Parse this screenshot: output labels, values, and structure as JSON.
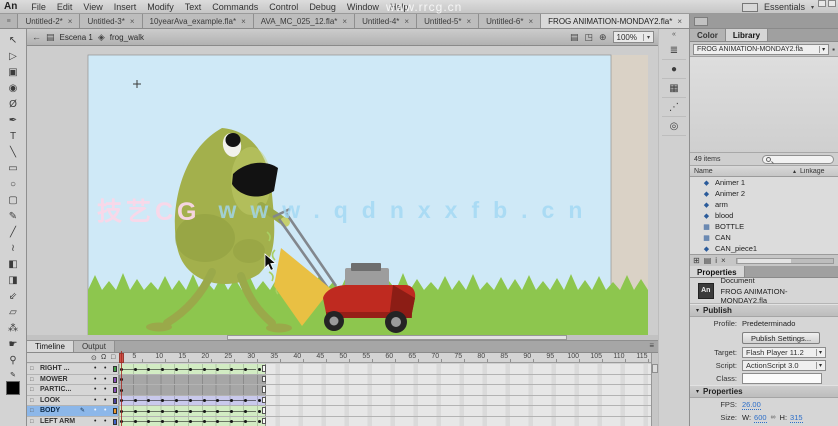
{
  "ui": {
    "close": "×",
    "dropdown": "▾",
    "back": "←",
    "scene_icon": "▤",
    "symbol_icon": "◈",
    "menu_icon": "≡",
    "collapse": "«",
    "eye": "⊙",
    "lock": "Ω",
    "outline": "□",
    "layer_icon": "□",
    "pencil": "✎",
    "sort": "▴",
    "movieclip_icon": "◆",
    "bitmap_icon": "▦",
    "pin": "▪",
    "dot": "•"
  },
  "menu_bar": {
    "logo": "An",
    "items": [
      "File",
      "Edit",
      "View",
      "Insert",
      "Modify",
      "Text",
      "Commands",
      "Control",
      "Debug",
      "Window",
      "Help"
    ],
    "watermark": "www.rrcg.cn",
    "workspace_label": "Essentials"
  },
  "document_tabs": [
    {
      "label": "Untitled-2*",
      "active": false
    },
    {
      "label": "Untitled-3*",
      "active": false
    },
    {
      "label": "10yearAva_example.fla*",
      "active": false
    },
    {
      "label": "AVA_MC_025_12.fla*",
      "active": false
    },
    {
      "label": "Untitled-4*",
      "active": false
    },
    {
      "label": "Untitled-5*",
      "active": false
    },
    {
      "label": "Untitled-6*",
      "active": false
    },
    {
      "label": "FROG ANIMATION-MONDAY2.fla*",
      "active": true
    }
  ],
  "edit_bar": {
    "scene": "Escena 1",
    "symbol": "frog_walk",
    "zoom_level": "100%",
    "right_icons": [
      {
        "name": "edit-scene-icon",
        "glyph": "▤"
      },
      {
        "name": "edit-symbols-icon",
        "glyph": "◳"
      },
      {
        "name": "center-frame-icon",
        "glyph": "⊕"
      }
    ]
  },
  "tools": [
    {
      "name": "selection-tool",
      "glyph": "↖"
    },
    {
      "name": "subselection-tool",
      "glyph": "▷"
    },
    {
      "name": "free-transform-tool",
      "glyph": "▣"
    },
    {
      "name": "3d-rotation-tool",
      "glyph": "◉"
    },
    {
      "name": "lasso-tool",
      "glyph": "Ø"
    },
    {
      "name": "pen-tool",
      "glyph": "✒"
    },
    {
      "name": "text-tool",
      "glyph": "T"
    },
    {
      "name": "line-tool",
      "glyph": "╲"
    },
    {
      "name": "rectangle-tool",
      "glyph": "▭"
    },
    {
      "name": "oval-tool",
      "glyph": "○"
    },
    {
      "name": "primitive-rect-tool",
      "glyph": "▢"
    },
    {
      "name": "pencil-tool",
      "glyph": "✎"
    },
    {
      "name": "brush-tool",
      "glyph": "╱"
    },
    {
      "name": "bone-tool",
      "glyph": "≀"
    },
    {
      "name": "paint-bucket-tool",
      "glyph": "◧"
    },
    {
      "name": "ink-bottle-tool",
      "glyph": "◨"
    },
    {
      "name": "eyedropper-tool",
      "glyph": "⇙"
    },
    {
      "name": "eraser-tool",
      "glyph": "▱"
    },
    {
      "name": "spray-brush-tool",
      "glyph": "⁂"
    },
    {
      "name": "hand-tool",
      "glyph": "☛"
    },
    {
      "name": "zoom-tool",
      "glyph": "⚲"
    }
  ],
  "stage": {
    "watermark_cjk": "技艺CG",
    "watermark_url": "www.qdnxxfb.cn"
  },
  "dock": {
    "icons": [
      {
        "name": "align-panel-icon",
        "glyph": "≣"
      },
      {
        "name": "info-panel-icon",
        "glyph": "●"
      },
      {
        "name": "transform-panel-icon",
        "glyph": "▦"
      },
      {
        "name": "code-snippets-icon",
        "glyph": "⋰"
      },
      {
        "name": "motion-presets-icon",
        "glyph": "◎"
      }
    ]
  },
  "library_panel": {
    "tabs": [
      {
        "label": "Color",
        "active": false
      },
      {
        "label": "Library",
        "active": true
      }
    ],
    "document_select": "FROG ANIMATION-MONDAY2.fla",
    "items_count": "49 items",
    "columns": {
      "name": "Name",
      "linkage": "Linkage"
    },
    "items": [
      {
        "name": "Animer 1",
        "type": "movieclip"
      },
      {
        "name": "Animer 2",
        "type": "movieclip"
      },
      {
        "name": "arm",
        "type": "movieclip"
      },
      {
        "name": "blood",
        "type": "movieclip"
      },
      {
        "name": "BOTTLE",
        "type": "bitmap"
      },
      {
        "name": "CAN",
        "type": "bitmap"
      },
      {
        "name": "CAN_piece1",
        "type": "movieclip"
      }
    ]
  },
  "properties_panel": {
    "tab": "Properties",
    "doc_icon": "An",
    "document_type": "Document",
    "document_name": "FROG ANIMATION-MONDAY2.fla",
    "publish_section": "Publish",
    "profile_label": "Profile:",
    "profile_value": "Predeterminado",
    "publish_settings_button": "Publish Settings...",
    "target_label": "Target:",
    "target_value": "Flash Player 11.2",
    "script_label": "Script:",
    "script_value": "ActionScript 3.0",
    "class_label": "Class:",
    "class_value": "",
    "properties_section": "Properties",
    "fps_label": "FPS:",
    "fps_value": "26.00",
    "size_label": "Size:",
    "w_label": "W:",
    "w_value": "600",
    "link_icon": "∞",
    "h_label": "H:",
    "h_value": "315"
  },
  "timeline": {
    "tabs": [
      {
        "label": "Timeline",
        "active": true
      },
      {
        "label": "Output",
        "active": false
      }
    ],
    "ruler_numbers": [
      5,
      10,
      15,
      20,
      25,
      30,
      35,
      40,
      45,
      50,
      55,
      60,
      65,
      70,
      75,
      80,
      85,
      90,
      95,
      100,
      105,
      110,
      115
    ],
    "playhead_frame": 1,
    "keyframe_interval": 3,
    "span_end_frame": 32,
    "layers": [
      {
        "name": "RIGHT ...",
        "swatch": "#44a148",
        "span": "tween",
        "tint": "green",
        "selected": false
      },
      {
        "name": "MOWER",
        "swatch": "#8a4bb8",
        "span": "static",
        "tint": "gray",
        "selected": false
      },
      {
        "name": "PARTIC...",
        "swatch": "#8a4bb8",
        "span": "static",
        "tint": "gray",
        "selected": false
      },
      {
        "name": "LOOK",
        "swatch": "#4a3f9e",
        "span": "tween",
        "tint": "blue",
        "selected": false
      },
      {
        "name": "BODY",
        "swatch": "#e8962e",
        "span": "tween",
        "tint": "green",
        "selected": true
      },
      {
        "name": "LEFT ARM",
        "swatch": "#3f62c8",
        "span": "tween",
        "tint": "green",
        "selected": false
      }
    ]
  },
  "colors": {
    "sky": "#cfe9f7",
    "grass": "#8dc64e",
    "pasteboard_right": "#dad2c6",
    "frog_body": "#a3b04c",
    "frog_shade": "#8b9c3e",
    "frog_highlight": "#c6d06e",
    "frog_limb": "#9aa94a",
    "mower_red": "#bf2a20",
    "mower_dark_red": "#8c1d15",
    "engine_gray": "#9d9d9d",
    "handle_gray": "#82878d",
    "bag_yellow": "#e9c043",
    "selection_blue": "#8cb7e9",
    "tween_green": "#d2ecc3",
    "tween_blue": "#c9c9ec",
    "static_gray": "#a6a6a6",
    "hot_text_blue": "#2d6fc9"
  }
}
